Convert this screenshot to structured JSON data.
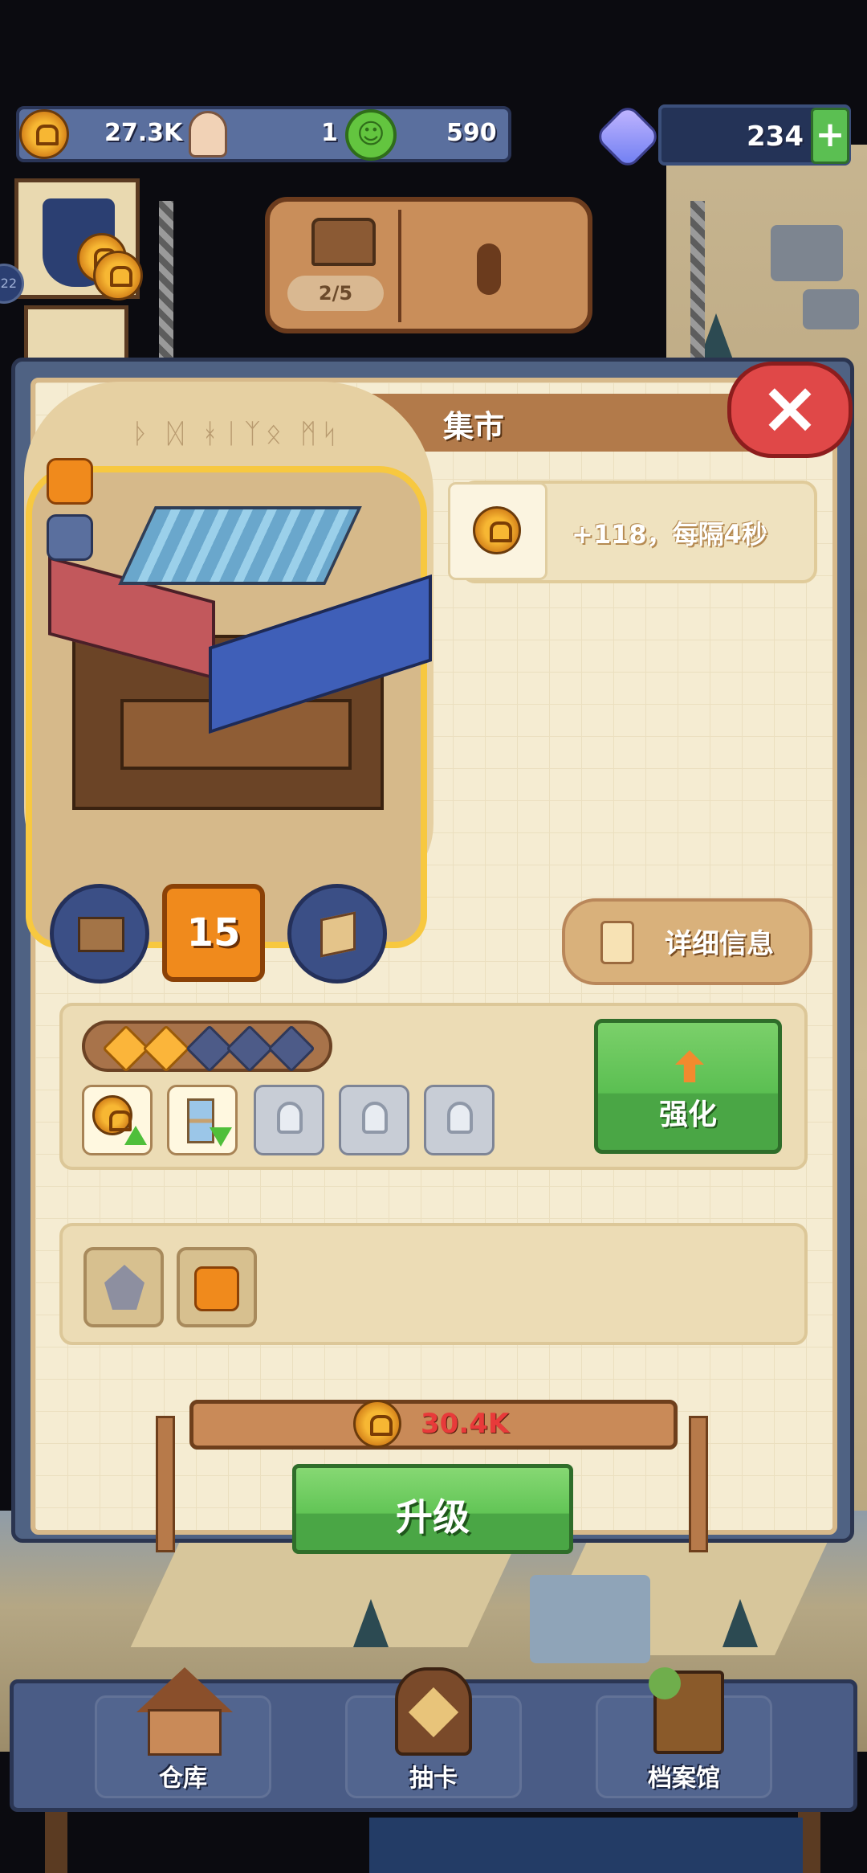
{
  "resources": {
    "gold": "27.3K",
    "population": "1",
    "happiness": "590",
    "gems": "234",
    "add_gems_label": "+"
  },
  "chest": {
    "progress": "2/5"
  },
  "side_badge": "22",
  "building": {
    "title": "集市",
    "level": "15",
    "production_text": "+118，每隔4秒",
    "detail_button": "详细信息",
    "stars_total": 5,
    "stars_filled": 2,
    "enhance_button": "强化",
    "upgrade_cost": "30.4K",
    "upgrade_button": "升级",
    "close_icon": "×"
  },
  "nav": {
    "items": [
      {
        "label": "仓库"
      },
      {
        "label": "抽卡"
      },
      {
        "label": "档案馆"
      }
    ]
  },
  "colors": {
    "panel_blue": "#4f6283",
    "parchment": "#f5ecd2",
    "green_button": "#62c556",
    "close_red": "#e04848",
    "cost_red": "#e83a3a",
    "level_orange": "#f08a1c"
  }
}
